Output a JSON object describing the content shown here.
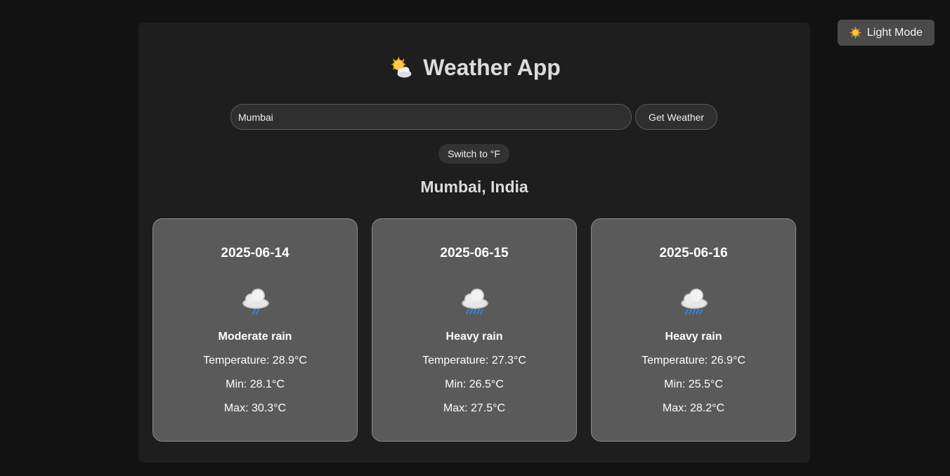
{
  "theme_toggle": {
    "label": "Light Mode",
    "icon": "sun-icon"
  },
  "header": {
    "title": "Weather App",
    "icon": "sun-cloud-icon"
  },
  "search": {
    "value": "Mumbai",
    "button_label": "Get Weather"
  },
  "unit_toggle": {
    "label": "Switch to °F"
  },
  "location": "Mumbai, India",
  "forecast": [
    {
      "date": "2025-06-14",
      "icon": "rain-cloud-icon",
      "condition": "Moderate rain",
      "temperature": "Temperature: 28.9°C",
      "min": "Min: 28.1°C",
      "max": "Max: 30.3°C"
    },
    {
      "date": "2025-06-15",
      "icon": "heavy-rain-cloud-icon",
      "condition": "Heavy rain",
      "temperature": "Temperature: 27.3°C",
      "min": "Min: 26.5°C",
      "max": "Max: 27.5°C"
    },
    {
      "date": "2025-06-16",
      "icon": "heavy-rain-cloud-icon",
      "condition": "Heavy rain",
      "temperature": "Temperature: 26.9°C",
      "min": "Min: 25.5°C",
      "max": "Max: 28.2°C"
    }
  ],
  "colors": {
    "page_bg": "#121212",
    "panel_bg": "#1e1e1e",
    "card_bg": "#5a5a5a",
    "rain": "#2f86e0"
  }
}
